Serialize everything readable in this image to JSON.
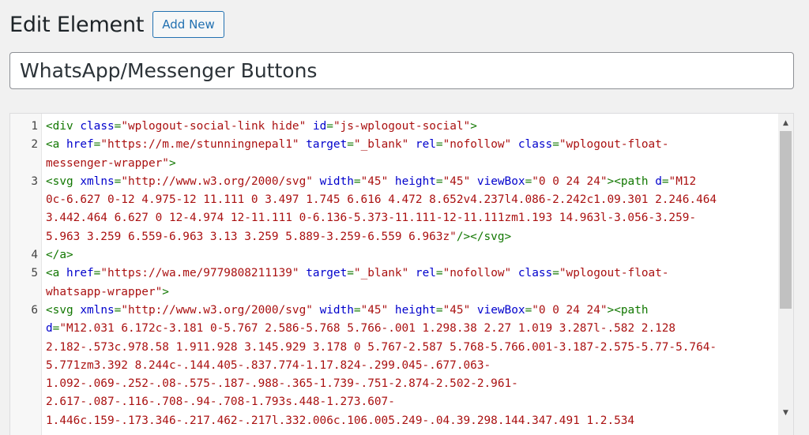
{
  "header": {
    "title": "Edit Element",
    "add_new_label": "Add New"
  },
  "element_title": {
    "value": "WhatsApp/Messenger Buttons"
  },
  "editor": {
    "lines": [
      {
        "number": "1",
        "visual": [
          [
            [
              "t",
              "<div "
            ],
            [
              "a",
              "class"
            ],
            [
              "p",
              "="
            ],
            [
              "s",
              "\"wplogout-social-link hide\""
            ],
            [
              "p",
              " "
            ],
            [
              "a",
              "id"
            ],
            [
              "p",
              "="
            ],
            [
              "s",
              "\"js-wplogout-social\""
            ],
            [
              "t",
              ">"
            ]
          ]
        ]
      },
      {
        "number": "2",
        "visual": [
          [
            [
              "t",
              "<a "
            ],
            [
              "a",
              "href"
            ],
            [
              "p",
              "="
            ],
            [
              "s",
              "\"https://m.me/stunningnepal1\""
            ],
            [
              "p",
              " "
            ],
            [
              "a",
              "target"
            ],
            [
              "p",
              "="
            ],
            [
              "s",
              "\"_blank\""
            ],
            [
              "p",
              " "
            ],
            [
              "a",
              "rel"
            ],
            [
              "p",
              "="
            ],
            [
              "s",
              "\"nofollow\""
            ],
            [
              "p",
              " "
            ],
            [
              "a",
              "class"
            ],
            [
              "p",
              "="
            ],
            [
              "s",
              "\"wplogout-float-"
            ]
          ],
          [
            [
              "s",
              "messenger-wrapper\""
            ],
            [
              "t",
              ">"
            ]
          ]
        ]
      },
      {
        "number": "3",
        "visual": [
          [
            [
              "t",
              "<svg "
            ],
            [
              "a",
              "xmlns"
            ],
            [
              "p",
              "="
            ],
            [
              "s",
              "\"http://www.w3.org/2000/svg\""
            ],
            [
              "p",
              " "
            ],
            [
              "a",
              "width"
            ],
            [
              "p",
              "="
            ],
            [
              "s",
              "\"45\""
            ],
            [
              "p",
              " "
            ],
            [
              "a",
              "height"
            ],
            [
              "p",
              "="
            ],
            [
              "s",
              "\"45\""
            ],
            [
              "p",
              " "
            ],
            [
              "a",
              "viewBox"
            ],
            [
              "p",
              "="
            ],
            [
              "s",
              "\"0 0 24 24\""
            ],
            [
              "t",
              "><path "
            ],
            [
              "a",
              "d"
            ],
            [
              "p",
              "="
            ],
            [
              "s",
              "\"M12"
            ]
          ],
          [
            [
              "s",
              "0c-6.627 0-12 4.975-12 11.111 0 3.497 1.745 6.616 4.472 8.652v4.237l4.086-2.242c1.09.301 2.246.464"
            ]
          ],
          [
            [
              "s",
              "3.442.464 6.627 0 12-4.974 12-11.111 0-6.136-5.373-11.111-12-11.111zm1.193 14.963l-3.056-3.259-"
            ]
          ],
          [
            [
              "s",
              "5.963 3.259 6.559-6.963 3.13 3.259 5.889-3.259-6.559 6.963z\""
            ],
            [
              "t",
              "/></svg>"
            ]
          ]
        ]
      },
      {
        "number": "4",
        "visual": [
          [
            [
              "t",
              "</a>"
            ]
          ]
        ]
      },
      {
        "number": "5",
        "visual": [
          [
            [
              "t",
              "<a "
            ],
            [
              "a",
              "href"
            ],
            [
              "p",
              "="
            ],
            [
              "s",
              "\"https://wa.me/9779808211139\""
            ],
            [
              "p",
              " "
            ],
            [
              "a",
              "target"
            ],
            [
              "p",
              "="
            ],
            [
              "s",
              "\"_blank\""
            ],
            [
              "p",
              " "
            ],
            [
              "a",
              "rel"
            ],
            [
              "p",
              "="
            ],
            [
              "s",
              "\"nofollow\""
            ],
            [
              "p",
              " "
            ],
            [
              "a",
              "class"
            ],
            [
              "p",
              "="
            ],
            [
              "s",
              "\"wplogout-float-"
            ]
          ],
          [
            [
              "s",
              "whatsapp-wrapper\""
            ],
            [
              "t",
              ">"
            ]
          ]
        ]
      },
      {
        "number": "6",
        "visual": [
          [
            [
              "t",
              "<svg "
            ],
            [
              "a",
              "xmlns"
            ],
            [
              "p",
              "="
            ],
            [
              "s",
              "\"http://www.w3.org/2000/svg\""
            ],
            [
              "p",
              " "
            ],
            [
              "a",
              "width"
            ],
            [
              "p",
              "="
            ],
            [
              "s",
              "\"45\""
            ],
            [
              "p",
              " "
            ],
            [
              "a",
              "height"
            ],
            [
              "p",
              "="
            ],
            [
              "s",
              "\"45\""
            ],
            [
              "p",
              " "
            ],
            [
              "a",
              "viewBox"
            ],
            [
              "p",
              "="
            ],
            [
              "s",
              "\"0 0 24 24\""
            ],
            [
              "t",
              "><path"
            ]
          ],
          [
            [
              "a",
              "d"
            ],
            [
              "p",
              "="
            ],
            [
              "s",
              "\"M12.031 6.172c-3.181 0-5.767 2.586-5.768 5.766-.001 1.298.38 2.27 1.019 3.287l-.582 2.128"
            ]
          ],
          [
            [
              "s",
              "2.182-.573c.978.58 1.911.928 3.145.929 3.178 0 5.767-2.587 5.768-5.766.001-3.187-2.575-5.77-5.764-"
            ]
          ],
          [
            [
              "s",
              "5.771zm3.392 8.244c-.144.405-.837.774-1.17.824-.299.045-.677.063-"
            ]
          ],
          [
            [
              "s",
              "1.092-.069-.252-.08-.575-.187-.988-.365-1.739-.751-2.874-2.502-2.961-"
            ]
          ],
          [
            [
              "s",
              "2.617-.087-.116-.708-.94-.708-1.793s.448-1.273.607-"
            ]
          ],
          [
            [
              "s",
              "1.446c.159-.173.346-.217.462-.217l.332.006c.106.005.249-.04.39.298.144.347.491 1.2.534"
            ]
          ]
        ]
      }
    ]
  }
}
